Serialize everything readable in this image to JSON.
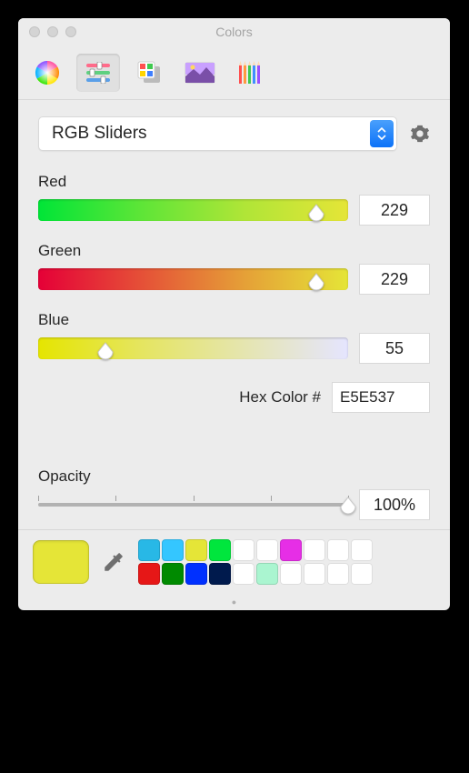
{
  "window": {
    "title": "Colors"
  },
  "mode": {
    "selected": "RGB Sliders"
  },
  "channels": {
    "red": {
      "label": "Red",
      "value": "229",
      "pct": 89.8
    },
    "green": {
      "label": "Green",
      "value": "229",
      "pct": 89.8
    },
    "blue": {
      "label": "Blue",
      "value": "55",
      "pct": 21.6
    }
  },
  "hex": {
    "label": "Hex Color #",
    "value": "E5E537"
  },
  "opacity": {
    "label": "Opacity",
    "value": "100%",
    "pct": 100
  },
  "current_color": "#e5e537",
  "swatches": {
    "row1": [
      "#28b8e6",
      "#34c6ff",
      "#e5e537",
      "#00e63d",
      "",
      "",
      "#e62ee6",
      "",
      "",
      ""
    ],
    "row2": [
      "#e61717",
      "#008a00",
      "#0030ff",
      "#001a4d",
      "",
      "#aaf5d0",
      "",
      "",
      "",
      ""
    ]
  }
}
